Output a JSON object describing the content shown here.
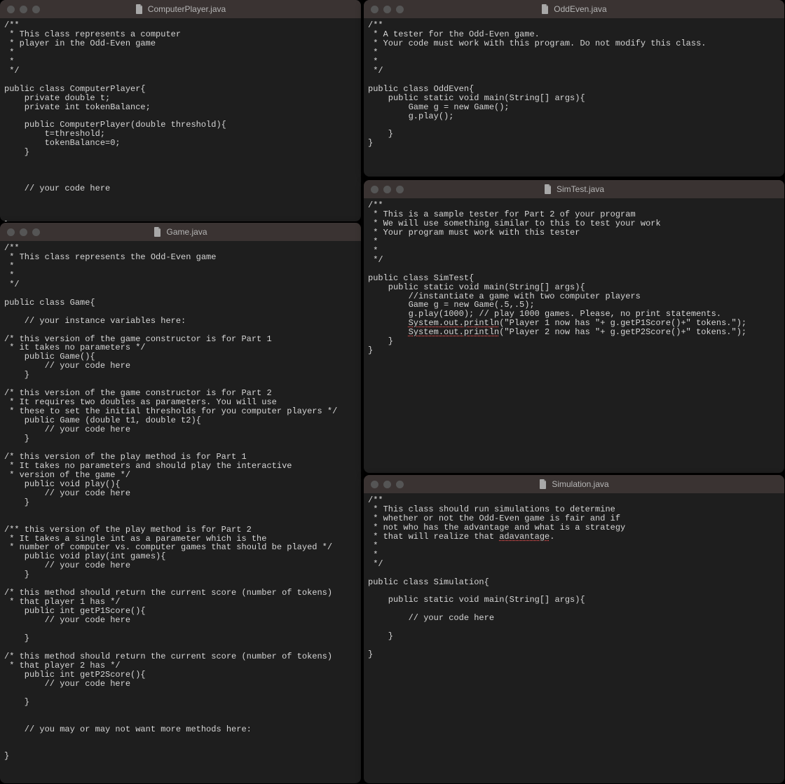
{
  "windows": {
    "comp": {
      "title": "ComputerPlayer.java",
      "code": "/**\n * This class represents a computer\n * player in the Odd-Even game\n *\n *\n */\n\npublic class ComputerPlayer{\n    private double t;\n    private int tokenBalance;\n\n    public ComputerPlayer(double threshold){\n        t=threshold;\n        tokenBalance=0;\n    }\n\n\n\n    // your code here\n\n\n\n}"
    },
    "odd": {
      "title": "OddEven.java",
      "code": "/**\n * A tester for the Odd-Even game.\n * Your code must work with this program. Do not modify this class.\n *\n *\n */\n\npublic class OddEven{\n    public static void main(String[] args){\n        Game g = new Game();\n        g.play();\n\n    }\n}"
    },
    "game": {
      "title": "Game.java",
      "code": "/**\n * This class represents the Odd-Even game\n *\n *\n */\n\npublic class Game{\n\n    // your instance variables here:\n\n/* this version of the game constructor is for Part 1\n * it takes no parameters */\n    public Game(){\n        // your code here\n    }\n\n/* this version of the game constructor is for Part 2\n * It requires two doubles as parameters. You will use\n * these to set the initial thresholds for you computer players */\n    public Game (double t1, double t2){\n        // your code here\n    }\n\n/* this version of the play method is for Part 1\n * It takes no parameters and should play the interactive\n * version of the game */\n    public void play(){\n        // your code here\n    }\n\n\n/** this version of the play method is for Part 2\n * It takes a single int as a parameter which is the\n * number of computer vs. computer games that should be played */\n    public void play(int games){\n        // your code here\n    }\n\n/* this method should return the current score (number of tokens)\n * that player 1 has */\n    public int getP1Score(){\n        // your code here\n\n    }\n\n/* this method should return the current score (number of tokens)\n * that player 2 has */\n    public int getP2Score(){\n        // your code here\n\n    }\n\n\n    // you may or may not want more methods here:\n\n\n}"
    },
    "sim": {
      "title": "SimTest.java",
      "code_pre": "/**\n * This is a sample tester for Part 2 of your program\n * We will use something similar to this to test your work\n * Your program must work with this tester\n *\n *\n */\n\npublic class SimTest{\n    public static void main(String[] args){\n        //instantiate a game with two computer players\n        Game g = new Game(.5,.5);\n        g.play(1000); // play 1000 games. Please, no print statements.\n        ",
      "sq1": "System.out.println",
      "mid1": "(\"Player 1 now has \"+ g.getP1Score()+\" tokens.\");\n        ",
      "sq2": "System.out.println",
      "code_post": "(\"Player 2 now has \"+ g.getP2Score()+\" tokens.\");\n    }\n}"
    },
    "simu": {
      "title": "Simulation.java",
      "code_pre": "/**\n * This class should run simulations to determine\n * whether or not the Odd-Even game is fair and if\n * not who has the advantage and what is a strategy\n * that will realize that ",
      "squig": "adavantage",
      "code_post": ".\n *\n *\n */\n\npublic class Simulation{\n\n    public static void main(String[] args){\n\n        // your code here\n\n    }\n\n}"
    }
  }
}
